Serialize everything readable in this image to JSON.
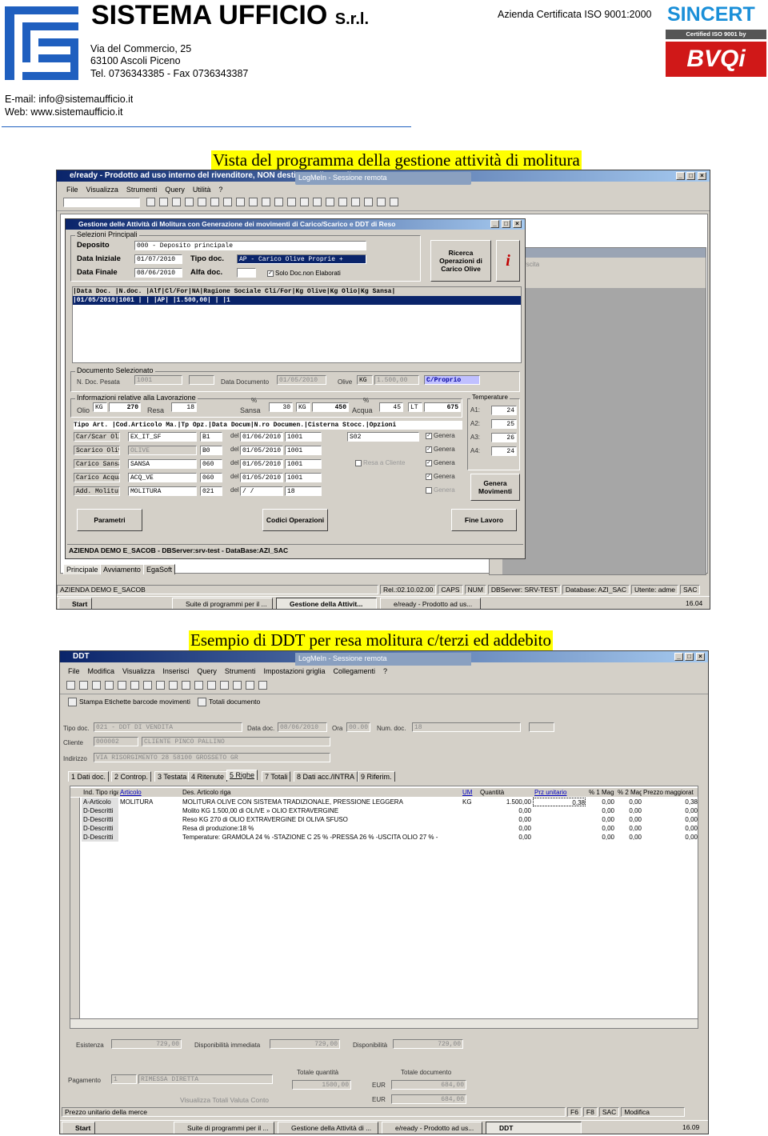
{
  "header": {
    "company": "SISTEMA UFFICIO",
    "company_suffix": "S.r.l.",
    "address1": "Via del Commercio, 25",
    "address2": "63100 Ascoli Piceno",
    "phone": "Tel. 0736343385 - Fax 0736343387",
    "email": "E-mail: info@sistemaufficio.it",
    "web": "Web: www.sistemaufficio.it",
    "certification": "Azienda Certificata ISO 9001:2000",
    "cert_logo1": "SINCERT",
    "cert_logo1_sub": "Certified ISO 9001 by",
    "cert_logo2": "BVQi"
  },
  "caption1": "Vista del programma della gestione attività di molitura",
  "caption2": "Esempio di DDT per resa molitura c/terzi ed addebito",
  "shot1": {
    "main_title": "e/ready - Prodotto ad uso interno del rivenditore, NON destinato alla vendita",
    "logmein": "LogMeIn - Sessione remota",
    "menu": [
      "File",
      "Visualizza",
      "Strumenti",
      "Query",
      "Utilità",
      "?"
    ],
    "dialog_title": "Gestione delle Attività di Molitura con Generazione dei movimenti di Carico/Scarico e DDT di Reso",
    "sel_caption": "Selezioni Principali",
    "deposito_label": "Deposito",
    "deposito_value": "000 - Deposito principale",
    "data_iniziale_label": "Data Iniziale",
    "data_iniziale_value": "01/07/2010",
    "tipo_doc_label": "Tipo doc.",
    "tipo_doc_value": "AP - Carico Olive Proprie +",
    "data_finale_label": "Data Finale",
    "data_finale_value": "08/06/2010",
    "alfa_doc_label": "Alfa doc.",
    "solo_doc": "Solo Doc.non Elaborati",
    "ricerca_btn": "Ricerca Operazioni di Carico Olive",
    "info_icon": "i",
    "grid_header": "|Data Doc. |N.doc. |Alf|Cl/For|NA|Ragione Sociale Cli/For|Kg Olive|Kg Olio|Kg Sansa|",
    "grid_row": "|01/05/2010|1001   |   |     |AP|                      |1.500,00|       |        |1",
    "doc_sel_caption": "Documento Selezionato",
    "n_doc_label": "N. Doc. Pesata",
    "n_doc_value": "1001",
    "data_doc_label": "Data Documento",
    "data_doc_value": "01/05/2010",
    "olive_label": "Olive",
    "olive_unit": "KG",
    "olive_value": "1.500,00",
    "cproprio": "C/Proprio",
    "info_lav_caption": "Informazioni relative alla Lavorazione",
    "olio_label": "Olio",
    "olio_unit": "KG",
    "olio_value": "270",
    "resa_label": "Resa",
    "resa_value": "18",
    "pct": "%",
    "sansa_label": "Sansa",
    "sansa_value": "30",
    "sansa_unit": "KG",
    "sansa_kg": "450",
    "acqua_label": "Acqua",
    "acqua_value": "45",
    "acqua_unit": "LT",
    "acqua_lt": "675",
    "temp_caption": "Temperature",
    "temps": [
      {
        "l": "A1:",
        "v": "24"
      },
      {
        "l": "A2:",
        "v": "25"
      },
      {
        "l": "A3:",
        "v": "26"
      },
      {
        "l": "A4:",
        "v": "24"
      }
    ],
    "mov_header": "Tipo Art. |Cod.Articolo Ma.|Tp Opz.|Data Docum|N.ro Documen.|Cisterna Stocc.|Opzioni",
    "mov_rows": [
      {
        "tipo": "Car/Scar Olio",
        "cod": "EX_IT_SF",
        "ma": "B1",
        "del": "del",
        "data": "01/06/2010",
        "num": "1001",
        "cist": "S02",
        "opt": "Genera",
        "checked": true
      },
      {
        "tipo": "Scarico Olive",
        "cod": "OLIVE",
        "ma": "B0",
        "del": "del",
        "data": "01/05/2010",
        "num": "1001",
        "cist": "",
        "opt": "Genera",
        "checked": true
      },
      {
        "tipo": "Carico Sansa",
        "cod": "SANSA",
        "ma": "060",
        "del": "del",
        "data": "01/05/2010",
        "num": "1001",
        "cist": "Resa a Cliente",
        "opt": "Genera",
        "checked": true
      },
      {
        "tipo": "Carico Acqua",
        "cod": "ACQ_VE",
        "ma": "060",
        "del": "del",
        "data": "01/05/2010",
        "num": "1001",
        "cist": "",
        "opt": "Genera",
        "checked": true
      },
      {
        "tipo": "Add. Molitura",
        "cod": "MOLITURA",
        "ma": "021",
        "del": "del",
        "data": "/ /",
        "num": "18",
        "cist": "",
        "opt": "Genera",
        "checked": false
      }
    ],
    "genera_btn": "Genera Movimenti",
    "parametri_btn": "Parametri",
    "codici_btn": "Codici Operazioni",
    "fine_btn": "Fine Lavoro",
    "dialog_status": "AZIENDA DEMO E_SACOB - DBServer:srv-test - DataBase:AZI_SAC",
    "tabs": [
      "Principale",
      "Avviamento",
      "EgaSoft"
    ],
    "status": [
      "AZIENDA DEMO E_SACOB",
      "Rel.:02.10.02.00",
      "CAPS",
      "NUM",
      "DBServer: SRV-TEST",
      "Database: AZI_SAC",
      "Utente: adme",
      "SAC"
    ],
    "taskbar": [
      "Start",
      "Suite di programmi per il ...",
      "Gestione della Attivit...",
      "e/ready - Prodotto ad us..."
    ],
    "clock": "16.04",
    "bg_window": "Uscita"
  },
  "shot2": {
    "main_title": "DDT",
    "logmein": "LogMeIn - Sessione remota",
    "menu": [
      "File",
      "Modifica",
      "Visualizza",
      "Inserisci",
      "Query",
      "Strumenti",
      "Impostazioni griglia",
      "Collegamenti",
      "?"
    ],
    "tool2": [
      "Stampa Etichette barcode movimenti",
      "Totali documento"
    ],
    "tipo_doc_label": "Tipo doc.",
    "tipo_doc_value": "021 - DDT DI VENDITA",
    "data_doc_label": "Data doc.",
    "data_doc_value": "08/06/2010",
    "ora_label": "Ora",
    "ora_value": "00.00",
    "num_doc_label": "Num. doc.",
    "num_doc_value": "18",
    "cliente_label": "Cliente",
    "cliente_code": "000002",
    "cliente_name": "CLIENTE PINCO PALLINO",
    "indirizzo_label": "Indirizzo",
    "indirizzo_value": "VIA RISORGIMENTO 28   58100   GROSSETO   GR",
    "tabs": [
      "1 Dati doc.",
      "2 Controp.",
      "3 Testata",
      "4 Ritenute",
      "5 Righe",
      "7 Totali",
      "8 Dati acc./INTRA",
      "9 Riferim."
    ],
    "cols": [
      "Ind. Tipo riga",
      "Articolo",
      "Des. Articolo riga",
      "UM",
      "Quantità",
      "Prz unitario",
      "% 1 Mag",
      "% 2 Mag",
      "Prezzo maggiorat"
    ],
    "rows": [
      {
        "tipo": "A-Articolo",
        "art": "MOLITURA",
        "des": "MOLITURA OLIVE CON SISTEMA TRADIZIONALE, PRESSIONE LEGGERA",
        "um": "KG",
        "qta": "1.500,00",
        "prz": "0,38",
        "m1": "0,00",
        "m2": "0,00",
        "pm": "0,38"
      },
      {
        "tipo": "D-Descritti",
        "art": "",
        "des": "Molito KG 1.500,00 di OLIVE » OLIO EXTRAVERGINE",
        "um": "",
        "qta": "0,00",
        "prz": "",
        "m1": "0,00",
        "m2": "0,00",
        "pm": "0,00"
      },
      {
        "tipo": "D-Descritti",
        "art": "",
        "des": "Reso KG 270 di OLIO EXTRAVERGINE DI OLIVA SFUSO",
        "um": "",
        "qta": "0,00",
        "prz": "",
        "m1": "0,00",
        "m2": "0,00",
        "pm": "0,00"
      },
      {
        "tipo": "D-Descritti",
        "art": "",
        "des": "Resa di produzione:18 %",
        "um": "",
        "qta": "0,00",
        "prz": "",
        "m1": "0,00",
        "m2": "0,00",
        "pm": "0,00"
      },
      {
        "tipo": "D-Descritti",
        "art": "",
        "des": "Temperature: GRAMOLA 24 % -STAZIONE C 25 % -PRESSA 26 % -USCITA OLIO 27 % -",
        "um": "",
        "qta": "0,00",
        "prz": "",
        "m1": "0,00",
        "m2": "0,00",
        "pm": "0,00"
      }
    ],
    "esistenza_label": "Esistenza",
    "esistenza_value": "729,00",
    "disp_imm_label": "Disponibilità immediata",
    "disp_imm_value": "729,00",
    "disp_label": "Disponibilità",
    "disp_value": "729,00",
    "pagamento_label": "Pagamento",
    "pagamento_code": "1",
    "pagamento_value": "RIMESSA DIRETTA",
    "tot_qta_label": "Totale quantità",
    "tot_qta_value": "1500,00",
    "tot_doc_label": "Totale documento",
    "eur": "EUR",
    "tot_doc1": "684,00",
    "tot_doc2": "684,00",
    "visualizza_btn": "Visualizza Totali Valuta Conto",
    "status_left": "Prezzo unitario della merce",
    "status_right": [
      "F6",
      "F8",
      "SAC",
      "Modifica"
    ],
    "taskbar": [
      "Start",
      "Suite di programmi per il ...",
      "Gestione della Attività di ...",
      "e/ready - Prodotto ad us...",
      "DDT"
    ],
    "clock": "16.09"
  }
}
